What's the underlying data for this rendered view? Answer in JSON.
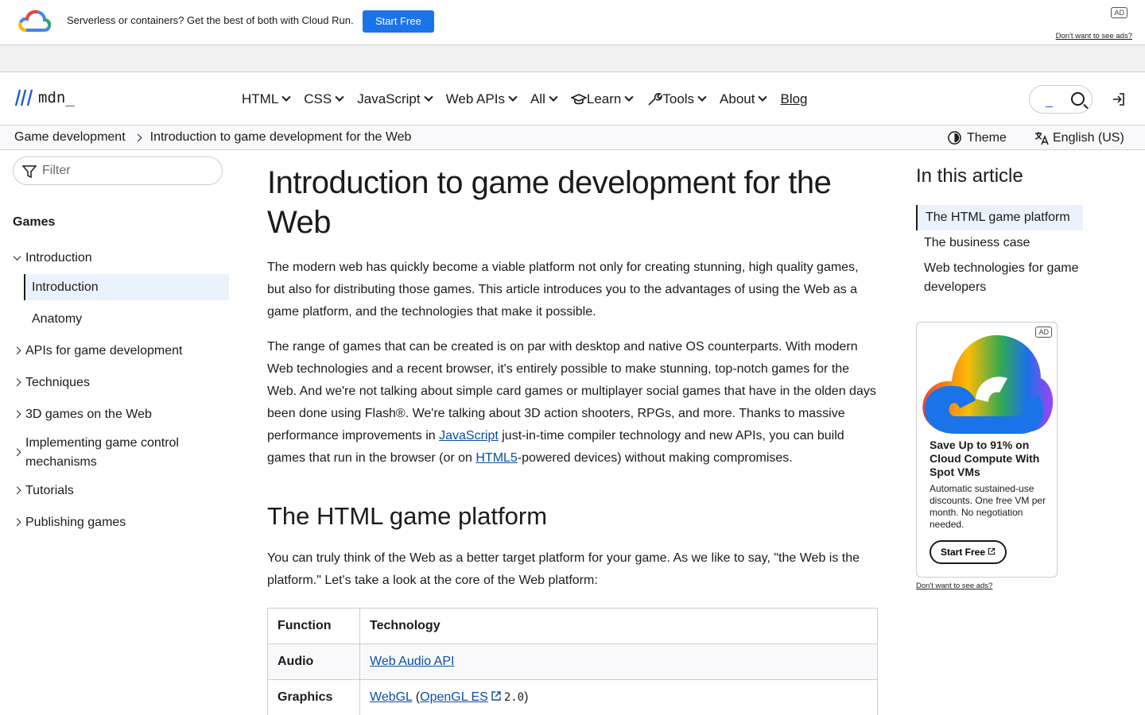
{
  "top_ad": {
    "message": "Serverless or containers? Get the best of both with Cloud Run.",
    "button": "Start Free",
    "badge": "AD",
    "no_ads": "Don't want to see ads?"
  },
  "nav": {
    "brand_mark": "M",
    "brand_word": "mdn_",
    "menu": [
      "HTML",
      "CSS",
      "JavaScript",
      "Web APIs",
      "All",
      "Learn",
      "Tools",
      "About"
    ],
    "blog": "Blog",
    "search_caret": "_"
  },
  "breadcrumb": {
    "parent": "Game development",
    "current": "Introduction to game development for the Web",
    "theme": "Theme",
    "language": "English (US)"
  },
  "sidebar": {
    "filter_placeholder": "Filter",
    "heading": "Games",
    "items": [
      "Introduction",
      "Introduction",
      "Anatomy",
      "APIs for game development",
      "Techniques",
      "3D games on the Web",
      "Implementing game control mechanisms",
      "Tutorials",
      "Publishing games"
    ]
  },
  "article": {
    "title": "Introduction to game development for the Web",
    "p1": "The modern web has quickly become a viable platform not only for creating stunning, high quality games, but also for distributing those games. This article introduces you to the advantages of using the Web as a game platform, and the technologies that make it possible.",
    "p2_a": "The range of games that can be created is on par with desktop and native OS counterparts. With modern Web technologies and a recent browser, it's entirely possible to make stunning, top-notch games for the Web. And we're not talking about simple card games or multiplayer social games that have in the olden days been done using Flash®. We're talking about 3D action shooters, RPGs, and more. Thanks to massive performance improvements in ",
    "p2_link1": "JavaScript",
    "p2_b": " just-in-time compiler technology and new APIs, you can build games that run in the browser (or on ",
    "p2_link2": "HTML5",
    "p2_c": "-powered devices) without making compromises.",
    "h2": "The HTML game platform",
    "p3": "You can truly think of the Web as a better target platform for your game. As we like to say, \"the Web is the platform.\" Let's take a look at the core of the Web platform:",
    "table": {
      "headers": [
        "Function",
        "Technology"
      ],
      "rows": [
        {
          "function": "Audio",
          "link": "Web Audio API"
        },
        {
          "function": "Graphics",
          "link": "WebGL",
          "link2": "OpenGL ES",
          "tail": "2.0"
        }
      ]
    }
  },
  "toc": {
    "heading": "In this article",
    "items": [
      "The HTML game platform",
      "The business case",
      "Web technologies for game developers"
    ]
  },
  "side_ad": {
    "badge": "AD",
    "title": "Save Up to 91% on Cloud Compute With Spot VMs",
    "desc": "Automatic sustained-use discounts. One free VM per month. No negotiation needed.",
    "button": "Start Free",
    "no_ads": "Don't want to see ads?"
  }
}
